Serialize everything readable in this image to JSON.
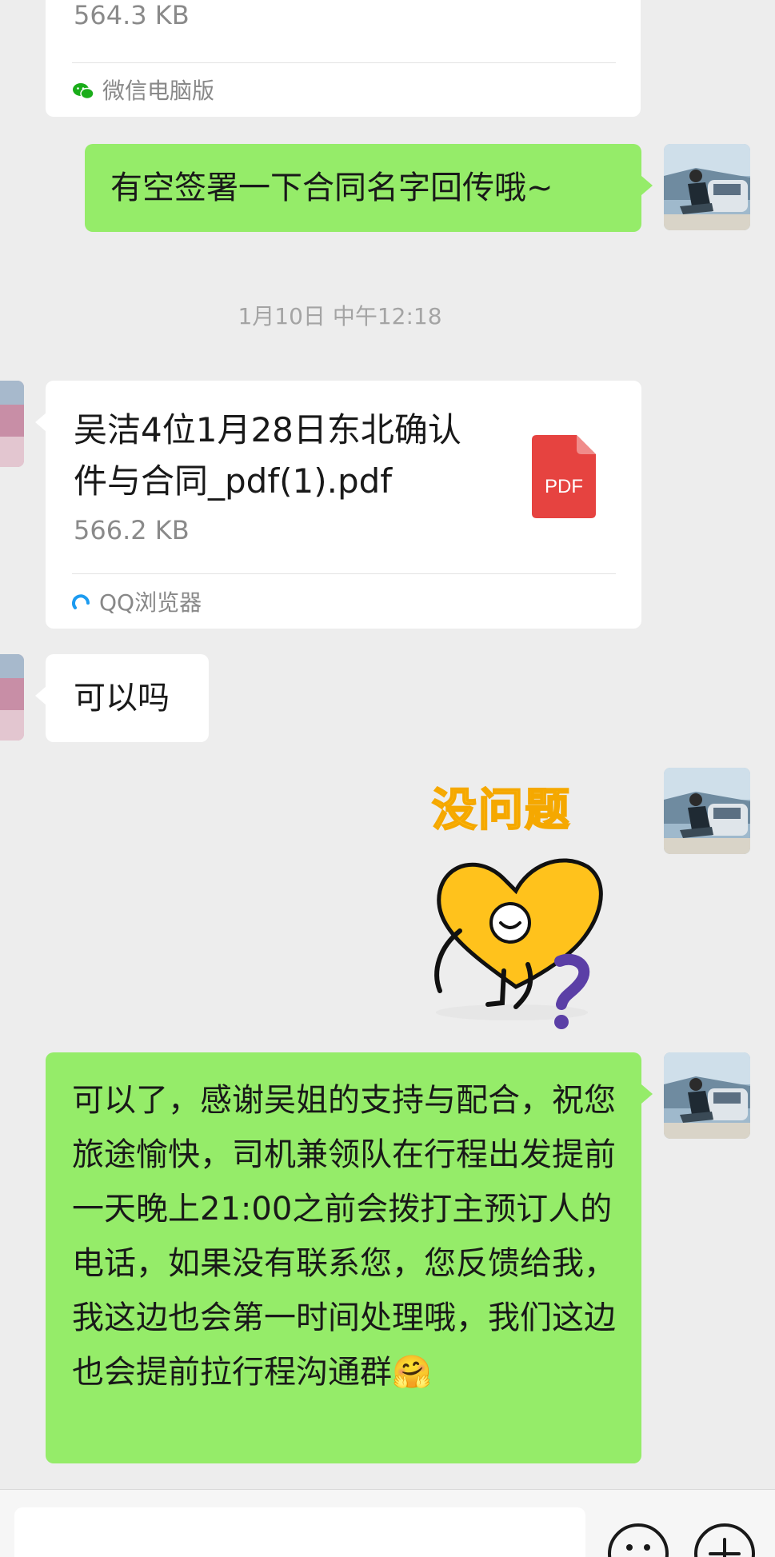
{
  "messages": {
    "top_card": {
      "size_partial": "564.3 KB",
      "source": "微信电脑版"
    },
    "sent_1": "有空签署一下合同名字回传哦~",
    "timestamp_1": "1月10日 中午12:18",
    "file_card": {
      "title": "吴洁4位1月28日东北确认件与合同_pdf(1).pdf",
      "size": "566.2 KB",
      "file_type_badge": "PDF",
      "source": "QQ浏览器"
    },
    "received_1": "可以吗",
    "sticker": {
      "caption": "没问题"
    },
    "sent_2": "可以了，感谢吴姐的支持与配合，祝您旅途愉快，司机兼领队在行程出发提前一天晚上21:00之前会拨打主预订人的电话，如果没有联系您，您反馈给我，我这边也会第一时间处理哦，我们这边也会提前拉行程沟通群🤗"
  },
  "input_bar": {
    "emoji_icon": "emoji-face-icon",
    "plus_icon": "plus-icon"
  },
  "colors": {
    "background": "#ededed",
    "bubble_sent": "#95ec69",
    "bubble_received": "#ffffff",
    "pdf_red": "#e64340",
    "sticker_yellow": "#ffc21c"
  }
}
